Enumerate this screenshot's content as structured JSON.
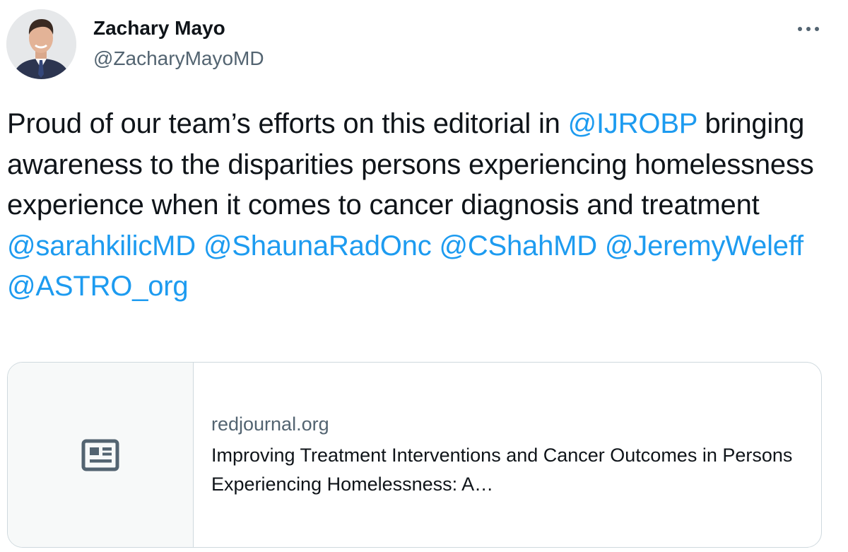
{
  "author": {
    "display_name": "Zachary Mayo",
    "handle": "@ZacharyMayoMD"
  },
  "menu": {
    "more_label": "···"
  },
  "tweet": {
    "segments": [
      {
        "text": "Proud of our team’s efforts on this editorial in ",
        "mention": false
      },
      {
        "text": "@IJROBP",
        "mention": true
      },
      {
        "text": " bringing awareness to the disparities persons experiencing homelessness experience when it comes to cancer diagnosis and treatment ",
        "mention": false
      },
      {
        "text": "@sarahkilicMD",
        "mention": true
      },
      {
        "text": " ",
        "mention": false
      },
      {
        "text": "@ShaunaRadOnc",
        "mention": true
      },
      {
        "text": " ",
        "mention": false
      },
      {
        "text": "@CShahMD",
        "mention": true
      },
      {
        "text": " ",
        "mention": false
      },
      {
        "text": "@JeremyWeleff",
        "mention": true
      },
      {
        "text": " ",
        "mention": false
      },
      {
        "text": "@ASTRO_org",
        "mention": true
      }
    ]
  },
  "link_card": {
    "domain": "redjournal.org",
    "title": "Improving Treatment Interventions and Cancer Outcomes in Persons Experiencing Homelessness: A…",
    "icon": "article-icon"
  },
  "colors": {
    "mention": "#1d9bf0",
    "text": "#0f1419",
    "secondary": "#536471",
    "border": "#cfd9de"
  }
}
